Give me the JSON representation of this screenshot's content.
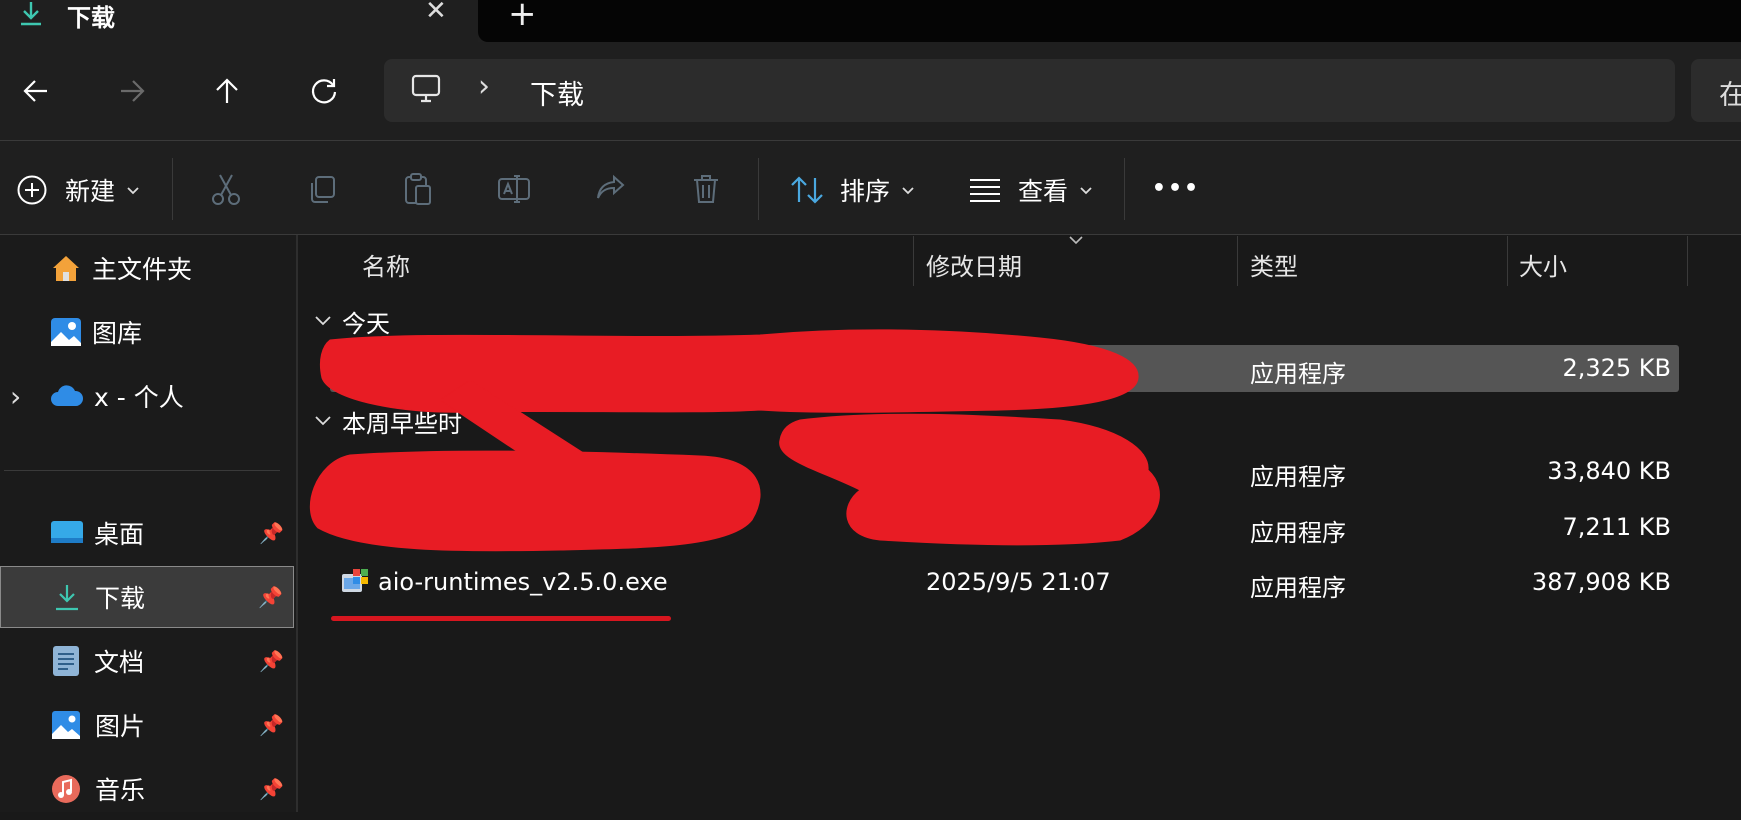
{
  "window": {
    "tab_title": "下载",
    "new_tab_glyph": "+",
    "close_glyph": "✕"
  },
  "nav": {
    "breadcrumb_sep": "›",
    "current_folder": "下载",
    "search_placeholder_partial": "在"
  },
  "toolbar": {
    "new_label": "新建",
    "sort_label": "排序",
    "view_label": "查看",
    "more_label": "•••"
  },
  "sidebar": {
    "items": [
      {
        "label": "主文件夹",
        "icon": "home-icon"
      },
      {
        "label": "图库",
        "icon": "gallery-icon"
      },
      {
        "label": "x - 个人",
        "icon": "onedrive-icon"
      },
      {
        "label": "桌面",
        "icon": "desktop-icon"
      },
      {
        "label": "下载",
        "icon": "download-icon"
      },
      {
        "label": "文档",
        "icon": "document-icon"
      },
      {
        "label": "图片",
        "icon": "pictures-icon"
      },
      {
        "label": "音乐",
        "icon": "music-icon"
      }
    ],
    "expand_glyph": "›"
  },
  "columns": {
    "name": "名称",
    "date": "修改日期",
    "type": "类型",
    "size": "大小"
  },
  "groups": {
    "today": "今天",
    "earlier_this_week": "本周早些时"
  },
  "rows": [
    {
      "name": "",
      "date": "",
      "type": "应用程序",
      "size": "2,325 KB"
    },
    {
      "name": "",
      "date": "",
      "type": "应用程序",
      "size": "33,840 KB"
    },
    {
      "name": "",
      "date": "",
      "type": "应用程序",
      "size": "7,211 KB"
    },
    {
      "name": "aio-runtimes_v2.5.0.exe",
      "date": "2025/9/5 21:07",
      "type": "应用程序",
      "size": "387,908 KB"
    }
  ],
  "colors": {
    "accent_teal": "#3ec7b0",
    "redaction": "#e81c24",
    "selected_row": "#555555",
    "underline": "#d7161f"
  }
}
